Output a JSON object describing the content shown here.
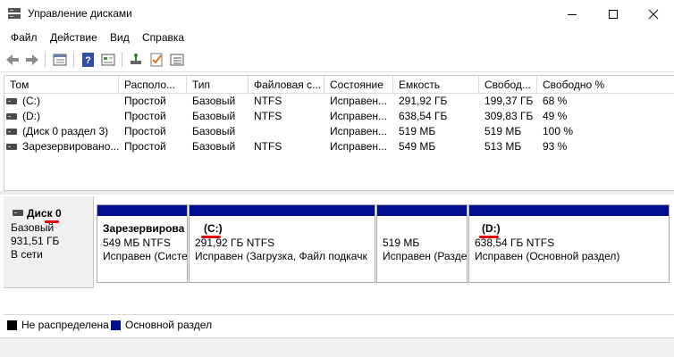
{
  "window": {
    "title": "Управление дисками"
  },
  "menu": [
    "Файл",
    "Действие",
    "Вид",
    "Справка"
  ],
  "volumes": {
    "columns": [
      "Том",
      "Располо...",
      "Тип",
      "Файловая с...",
      "Состояние",
      "Емкость",
      "Свобод...",
      "Свободно %"
    ],
    "rows": [
      [
        "(C:)",
        "Простой",
        "Базовый",
        "NTFS",
        "Исправен...",
        "291,92 ГБ",
        "199,37 ГБ",
        "68 %"
      ],
      [
        "(D:)",
        "Простой",
        "Базовый",
        "NTFS",
        "Исправен...",
        "638,54 ГБ",
        "309,83 ГБ",
        "49 %"
      ],
      [
        "(Диск 0 раздел 3)",
        "Простой",
        "Базовый",
        "",
        "Исправен...",
        "519 МБ",
        "519 МБ",
        "100 %"
      ],
      [
        "Зарезервировано...",
        "Простой",
        "Базовый",
        "NTFS",
        "Исправен...",
        "549 МБ",
        "513 МБ",
        "93 %"
      ]
    ]
  },
  "disk": {
    "name": "Диск 0",
    "type": "Базовый",
    "size": "931,51 ГБ",
    "status": "В сети"
  },
  "partitions": [
    {
      "name": "Зарезервирова",
      "size": "549 МБ NTFS",
      "status": "Исправен (Систе"
    },
    {
      "name": "(C:)",
      "size": "291,92 ГБ NTFS",
      "status": "Исправен (Загрузка, Файл подкачк"
    },
    {
      "name": "",
      "size": "519 МБ",
      "status": "Исправен (Разде"
    },
    {
      "name": "(D:)",
      "size": "638,54 ГБ NTFS",
      "status": "Исправен (Основной раздел)"
    }
  ],
  "legend": [
    {
      "label": "Не распределена",
      "color": "#000000"
    },
    {
      "label": "Основной раздел",
      "color": "#000f8f"
    }
  ],
  "colors": {
    "partition_bar": "#000f8f",
    "annotation": "#e00000"
  }
}
